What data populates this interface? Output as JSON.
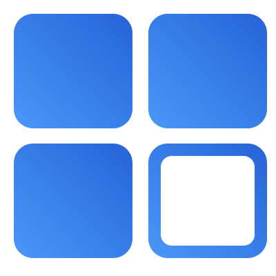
{
  "icon": {
    "name": "grid-app-icon",
    "tiles": [
      {
        "name": "tile-top-left",
        "style": "filled"
      },
      {
        "name": "tile-top-right",
        "style": "filled"
      },
      {
        "name": "tile-bottom-left",
        "style": "filled"
      },
      {
        "name": "tile-bottom-right",
        "style": "outlined"
      }
    ],
    "colors": {
      "gradient_start": "#4A98F8",
      "gradient_end": "#2563D8",
      "inner_fill": "#FFFFFF",
      "background": "#FFFFFF"
    }
  }
}
